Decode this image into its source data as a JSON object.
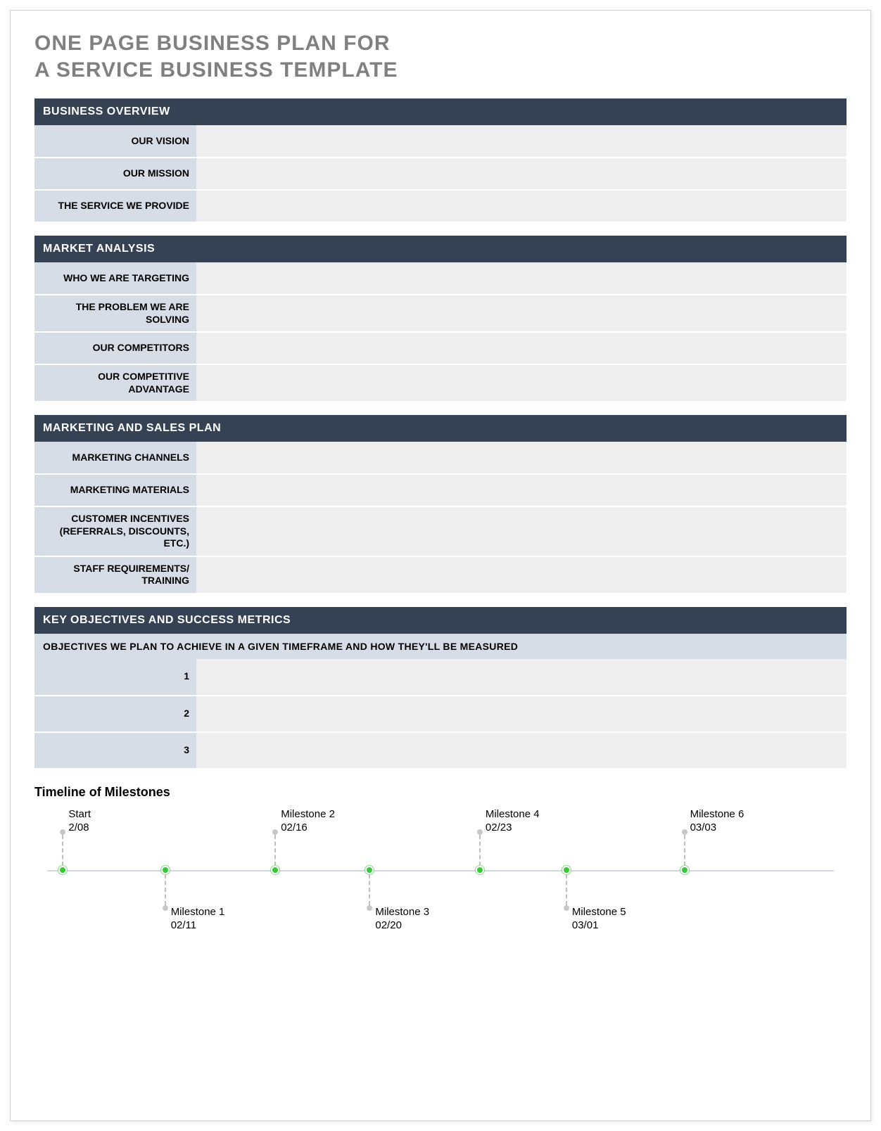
{
  "title_line1": "ONE PAGE BUSINESS PLAN FOR",
  "title_line2": "A SERVICE BUSINESS TEMPLATE",
  "sections": {
    "business_overview": {
      "header": "BUSINESS OVERVIEW",
      "rows": [
        {
          "label": "OUR VISION",
          "value": ""
        },
        {
          "label": "OUR MISSION",
          "value": ""
        },
        {
          "label": "THE SERVICE WE PROVIDE",
          "value": ""
        }
      ]
    },
    "market_analysis": {
      "header": "MARKET ANALYSIS",
      "rows": [
        {
          "label": "WHO WE ARE TARGETING",
          "value": ""
        },
        {
          "label": "THE PROBLEM WE ARE SOLVING",
          "value": ""
        },
        {
          "label": "OUR COMPETITORS",
          "value": ""
        },
        {
          "label": "OUR COMPETITIVE ADVANTAGE",
          "value": ""
        }
      ]
    },
    "marketing_sales": {
      "header": "MARKETING AND SALES PLAN",
      "rows": [
        {
          "label": "MARKETING CHANNELS",
          "value": ""
        },
        {
          "label": "MARKETING MATERIALS",
          "value": ""
        },
        {
          "label": "CUSTOMER INCENTIVES (REFERRALS, DISCOUNTS, ETC.)",
          "value": ""
        },
        {
          "label": "STAFF REQUIREMENTS/ TRAINING",
          "value": ""
        }
      ]
    },
    "key_objectives": {
      "header": "KEY OBJECTIVES AND SUCCESS METRICS",
      "subhead": "OBJECTIVES WE PLAN TO ACHIEVE IN A GIVEN TIMEFRAME AND HOW THEY'LL BE MEASURED",
      "rows": [
        {
          "label": "1",
          "value": ""
        },
        {
          "label": "2",
          "value": ""
        },
        {
          "label": "3",
          "value": ""
        }
      ]
    }
  },
  "timeline": {
    "title": "Timeline of Milestones",
    "points": [
      {
        "name": "Start",
        "date": "2/08",
        "pos": 2,
        "side": "up"
      },
      {
        "name": "Milestone 1",
        "date": "02/11",
        "pos": 15,
        "side": "down"
      },
      {
        "name": "Milestone 2",
        "date": "02/16",
        "pos": 29,
        "side": "up"
      },
      {
        "name": "Milestone 3",
        "date": "02/20",
        "pos": 41,
        "side": "down"
      },
      {
        "name": "Milestone 4",
        "date": "02/23",
        "pos": 55,
        "side": "up"
      },
      {
        "name": "Milestone 5",
        "date": "03/01",
        "pos": 66,
        "side": "down"
      },
      {
        "name": "Milestone 6",
        "date": "03/03",
        "pos": 81,
        "side": "up"
      }
    ]
  }
}
